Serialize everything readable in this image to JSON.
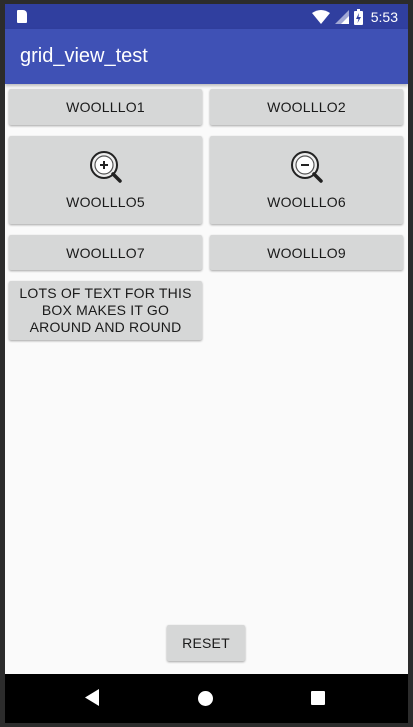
{
  "status_bar": {
    "time": "5:53",
    "icons": [
      "sd-card-icon",
      "wifi-icon",
      "signal-icon",
      "battery-icon"
    ]
  },
  "app_bar": {
    "title": "grid_view_test"
  },
  "grid": {
    "items": [
      {
        "label": "WOOLLLO1"
      },
      {
        "label": "WOOLLLO2"
      },
      {
        "label": "WOOLLLO5",
        "icon": "zoom-in-icon"
      },
      {
        "label": "WOOLLLO6",
        "icon": "zoom-out-icon"
      },
      {
        "label": "WOOLLLO7"
      },
      {
        "label": "WOOLLLO9"
      },
      {
        "label": "LOTS OF TEXT FOR THIS BOX MAKES IT GO AROUND AND ROUND"
      }
    ]
  },
  "reset_button": {
    "label": "RESET"
  },
  "nav_bar": {
    "icons": [
      "back-icon",
      "home-icon",
      "recents-icon"
    ]
  },
  "colors": {
    "status_bar": "#303f9f",
    "app_bar": "#3f51b5",
    "button": "#d6d7d7",
    "background": "#fafafa"
  }
}
